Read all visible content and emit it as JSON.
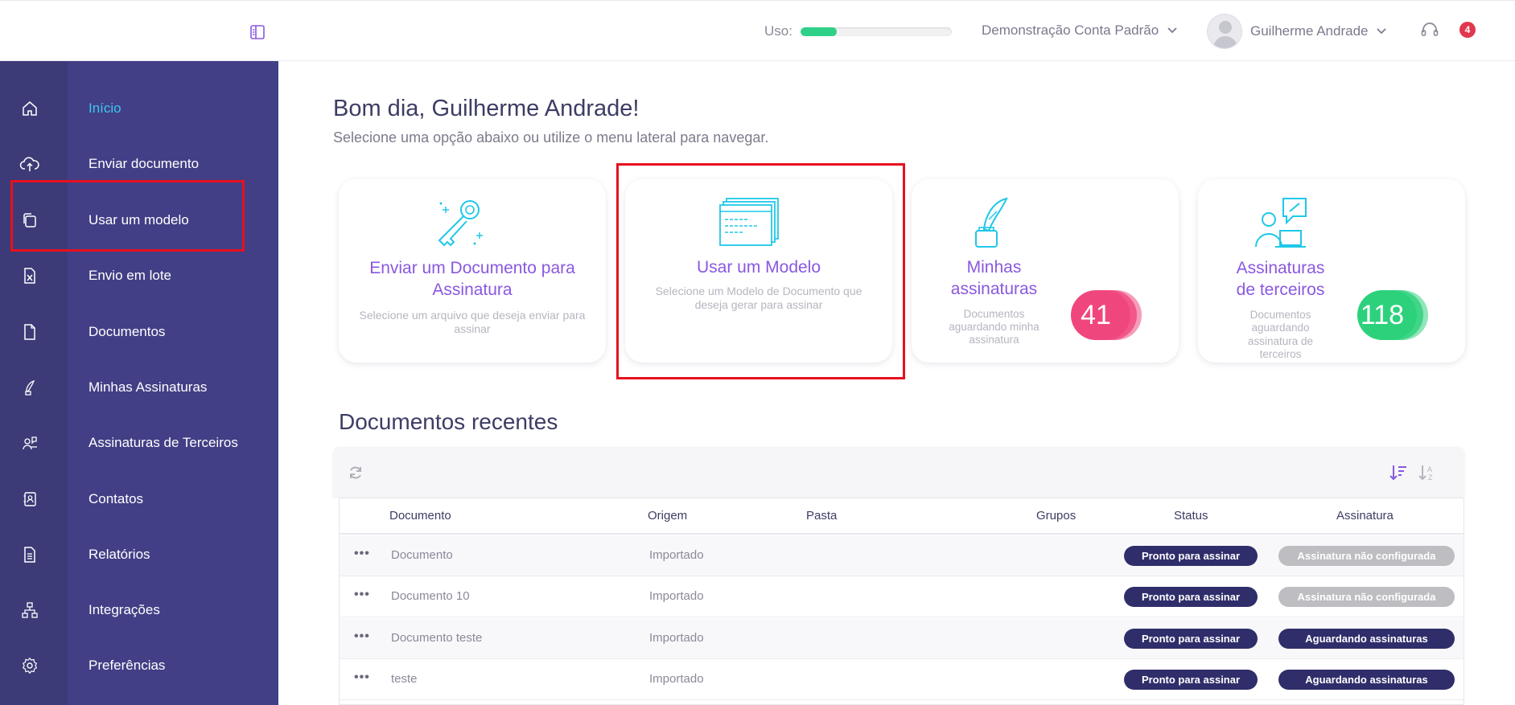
{
  "header": {
    "usage_label": "Uso:",
    "usage_fraction": 0.24,
    "account_name": "Demonstração Conta Padrão",
    "user_name": "Guilherme Andrade",
    "notification_count": "4"
  },
  "sidebar": {
    "items": [
      {
        "label": "Início",
        "icon": "home-icon",
        "active": true
      },
      {
        "label": "Enviar documento",
        "icon": "cloud-upload-icon"
      },
      {
        "label": "Usar um modelo",
        "icon": "template-icon"
      },
      {
        "label": "Envio em lote",
        "icon": "spreadsheet-file-icon"
      },
      {
        "label": "Documentos",
        "icon": "document-icon"
      },
      {
        "label": "Minhas Assinaturas",
        "icon": "quill-pen-icon"
      },
      {
        "label": "Assinaturas de Terceiros",
        "icon": "third-party-signature-icon"
      },
      {
        "label": "Contatos",
        "icon": "contact-book-icon"
      },
      {
        "label": "Relatórios",
        "icon": "report-icon"
      },
      {
        "label": "Integrações",
        "icon": "network-icon"
      },
      {
        "label": "Preferências",
        "icon": "gear-icon"
      }
    ]
  },
  "main": {
    "greeting": "Bom dia, Guilherme Andrade!",
    "subtitle": "Selecione uma opção abaixo ou utilize o menu lateral para navegar.",
    "cards": [
      {
        "title_line1": "Enviar um Documento para",
        "title_line2": "Assinatura",
        "desc_line1": "Selecione um arquivo que deseja enviar para",
        "desc_line2": "assinar"
      },
      {
        "title_line1": "Usar um Modelo",
        "desc_line1": "Selecione um Modelo de Documento que",
        "desc_line2": "deseja gerar para assinar"
      },
      {
        "title_line1": "Minhas",
        "title_line2": "assinaturas",
        "desc_line1": "Documentos",
        "desc_line2": "aguardando minha",
        "desc_line3": "assinatura",
        "count": "41",
        "count_color": "#f0467e"
      },
      {
        "title_line1": "Assinaturas",
        "title_line2": "de terceiros",
        "desc_line1": "Documentos",
        "desc_line2": "aguardando",
        "desc_line3": "assinatura de",
        "desc_line4": "terceiros",
        "count": "118",
        "count_color": "#2dd17c"
      }
    ],
    "recent_title": "Documentos recentes",
    "table": {
      "columns": [
        "Documento",
        "Origem",
        "Pasta",
        "Grupos",
        "Status",
        "Assinatura"
      ],
      "rows": [
        {
          "documento": "Documento",
          "origem": "Importado",
          "status": "Pronto para assinar",
          "assinatura": "Assinatura não configurada",
          "sig_style": "gray"
        },
        {
          "documento": "Documento 10",
          "origem": "Importado",
          "status": "Pronto para assinar",
          "assinatura": "Assinatura não configurada",
          "sig_style": "gray"
        },
        {
          "documento": "Documento teste",
          "origem": "Importado",
          "status": "Pronto para assinar",
          "assinatura": "Aguardando assinaturas",
          "sig_style": "navy"
        },
        {
          "documento": "teste",
          "origem": "Importado",
          "status": "Pronto para assinar",
          "assinatura": "Aguardando assinaturas",
          "sig_style": "navy"
        }
      ]
    }
  },
  "colors": {
    "sidebar_rail": "#3c3b77",
    "sidebar_menu": "#423f86",
    "accent_purple": "#8a58e0",
    "accent_cyan": "#1fc8e8",
    "highlight_red": "#e8101e"
  }
}
